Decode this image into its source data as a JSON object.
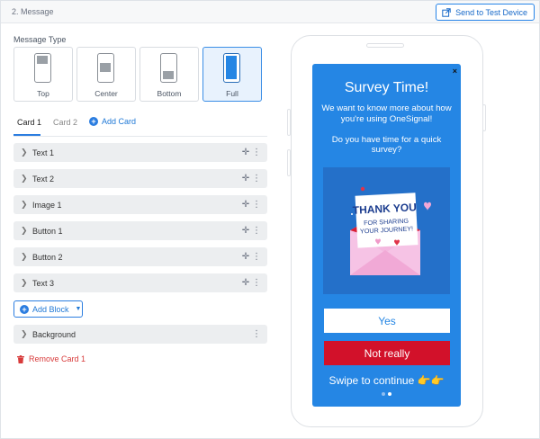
{
  "header": {
    "title": "2. Message",
    "send_button": "Send to Test Device"
  },
  "message_type": {
    "label": "Message Type",
    "options": [
      "Top",
      "Center",
      "Bottom",
      "Full"
    ],
    "selected": "Full"
  },
  "cards": {
    "tabs": [
      "Card 1",
      "Card 2"
    ],
    "active_tab": "Card 1",
    "add_card": "Add Card"
  },
  "blocks": [
    "Text 1",
    "Text 2",
    "Image 1",
    "Button 1",
    "Button 2",
    "Text 3"
  ],
  "add_block": "Add Block",
  "background_block": "Background",
  "remove_card": "Remove Card 1",
  "preview": {
    "title": "Survey Time!",
    "body": "We want to know more about how you're using OneSignal!\n\nDo you have time for a quick survey?",
    "image": {
      "line1": "THANK YOU",
      "line2": "FOR SHARING",
      "line3": "YOUR JOURNEY!"
    },
    "yes_button": "Yes",
    "no_button": "Not really",
    "swipe_text": "Swipe to continue",
    "swipe_emoji": "👉👉",
    "close": "×"
  },
  "colors": {
    "accent": "#2b7de0",
    "preview_bg": "#2586e4",
    "danger": "#d2112a",
    "selected_bg": "#e8f2fd"
  }
}
